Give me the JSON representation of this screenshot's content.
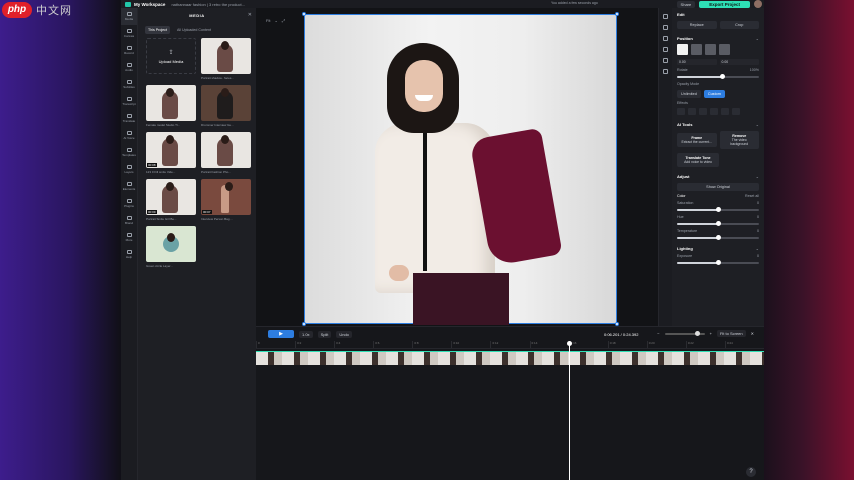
{
  "watermark": {
    "logo": "php",
    "text": "中文网"
  },
  "topbar": {
    "workspace": "My Workspace",
    "project": "nathannaar fashion | 3 retro the product...",
    "notice": "You added a few seconds ago",
    "share_label": "Share",
    "export_label": "Export Project"
  },
  "rail": {
    "items": [
      {
        "label": "Media",
        "icon": "media-icon"
      },
      {
        "label": "Canvas",
        "icon": "canvas-icon"
      },
      {
        "label": "Record",
        "icon": "record-icon"
      },
      {
        "label": "Audio",
        "icon": "audio-icon"
      },
      {
        "label": "Subtitles",
        "icon": "subtitles-icon"
      },
      {
        "label": "Transcript",
        "icon": "transcript-icon"
      },
      {
        "label": "Translate",
        "icon": "translate-icon"
      },
      {
        "label": "AI Voice",
        "icon": "ai-voice-icon"
      },
      {
        "label": "Templates",
        "icon": "templates-icon"
      },
      {
        "label": "Layers",
        "icon": "layers-icon"
      },
      {
        "label": "Elements",
        "icon": "elements-icon"
      },
      {
        "label": "Plugins",
        "icon": "plugins-icon"
      },
      {
        "label": "Brand",
        "icon": "brand-icon"
      },
      {
        "label": "More",
        "icon": "more-icon"
      },
      {
        "label": "Help",
        "icon": "help-icon"
      }
    ]
  },
  "media": {
    "title": "MEDIA",
    "tabs": [
      "This Project",
      "All Uploaded Content"
    ],
    "upload_label": "Upload Media",
    "items": [
      {
        "caption": "Portrait shadow.. faces...",
        "style": "light",
        "duration": ""
      },
      {
        "caption": "Female model Studio Tr...",
        "style": "light",
        "duration": ""
      },
      {
        "caption": "Drummer Interview Gu...",
        "style": "dark",
        "duration": ""
      },
      {
        "caption": "123 0 Fill smile Vide...",
        "style": "light",
        "duration": "00:08"
      },
      {
        "caption": "Portrait Fashion Pho...",
        "style": "light",
        "duration": ""
      },
      {
        "caption": "Portrait Smile Girl Be...",
        "style": "light",
        "duration": "00:09"
      },
      {
        "caption": "Interview Person Bag ...",
        "style": "warm",
        "duration": "00:07"
      },
      {
        "caption": "Green circle Layer...",
        "style": "circle",
        "duration": ""
      }
    ]
  },
  "stage": {
    "fit_label": "Fit",
    "tools": [
      "Fit",
      "⌄",
      "⤢"
    ]
  },
  "timeline": {
    "play_icon": "▶",
    "speed": "1.0x",
    "split_label": "Split",
    "undo_label": "Undo",
    "time": "0:06.201 / 0:24.392",
    "fit_label": "Fit to Screen",
    "ruler": [
      "0",
      "0:2",
      "0:4",
      "0:6",
      "0:8",
      "0:10",
      "0:12",
      "0:14",
      "0:16",
      "0:18",
      "0:20",
      "0:22",
      "0:24"
    ]
  },
  "props": {
    "title": "Edit",
    "replace_label": "Replace",
    "crop_label": "Crop",
    "position_label": "Position",
    "x_field": "0.00",
    "y_field": "0.00",
    "rotate_label": "Rotate",
    "rotate_value": "100%",
    "rotate_level": 0.55,
    "opacity_label": "Opacity Mode",
    "mode_options": [
      "Unlimited",
      "Custom"
    ],
    "effects_label": "Effects",
    "ai_tools_label": "AI Tools",
    "tools": [
      {
        "name": "Frame",
        "desc": "Extract the current..."
      },
      {
        "name": "Remove",
        "desc": "The video background"
      },
      {
        "name": "Translate Tone",
        "desc": "Add voice to video"
      }
    ],
    "adjust_label": "Adjust",
    "auto_label": "Show Original",
    "color_label": "Color",
    "reset_label": "Reset all",
    "sliders": [
      {
        "name": "Saturation",
        "value": "0",
        "level": 0.5
      },
      {
        "name": "Hue",
        "value": "0",
        "level": 0.5
      },
      {
        "name": "Temperature",
        "value": "0",
        "level": 0.5
      }
    ],
    "lighting_label": "Lighting",
    "exposure_label": "Exposure",
    "exposure_value": "0",
    "exposure_level": 0.5
  }
}
